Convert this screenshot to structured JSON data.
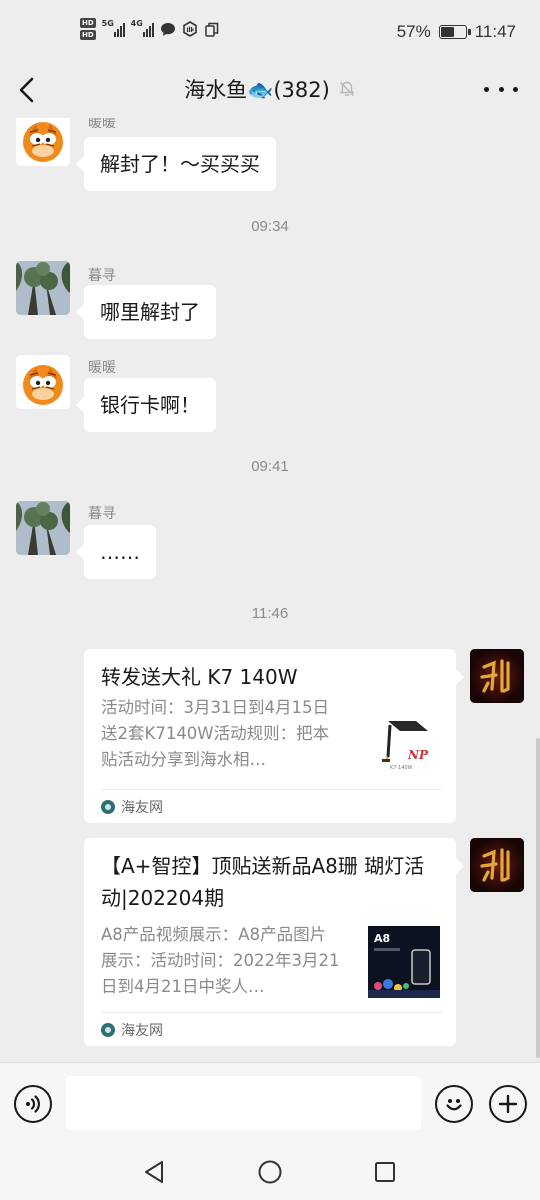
{
  "status_bar": {
    "hd1": "HD",
    "hd2": "HD",
    "signal1": "5G",
    "signal2": "4G",
    "battery_percent": "57%",
    "battery_level": 0.57,
    "time": "11:47"
  },
  "header": {
    "title": "海水鱼🐟(382)",
    "muted": true
  },
  "messages": [
    {
      "sender": "暖暖",
      "text": "解封了！～买买买"
    },
    {
      "time": "09:34"
    },
    {
      "sender": "暮寻",
      "text": "哪里解封了"
    },
    {
      "sender": "暖暖",
      "text": "银行卡啊！"
    },
    {
      "time": "09:41"
    },
    {
      "sender": "暮寻",
      "text": "……"
    },
    {
      "time": "11:46"
    },
    {
      "card_title": "转发送大礼 K7 140W",
      "card_desc": "活动时间：3月31日到4月15日送2套K7140W活动规则：把本贴活动分享到海水相…",
      "card_source": "海友网",
      "thumb_brand": "NP",
      "thumb_caption": "K7 140W"
    },
    {
      "card_title": "【A+智控】顶贴送新品A8珊 瑚灯活动|202204期",
      "card_desc": "A8产品视频展示：A8产品图片展示：活动时间：2022年3月21日到4月21日中奖人…",
      "card_source": "海友网",
      "thumb_label": "A8"
    }
  ],
  "input": {
    "placeholder": ""
  },
  "icons": {
    "back": "back-arrow-icon",
    "mute": "mute-bell-icon",
    "more": "more-dots-icon",
    "voice": "voice-icon",
    "emoji": "emoji-icon",
    "plus": "plus-icon",
    "sys_back": "triangle-back-icon",
    "sys_home": "circle-home-icon",
    "sys_recent": "square-recent-icon"
  }
}
